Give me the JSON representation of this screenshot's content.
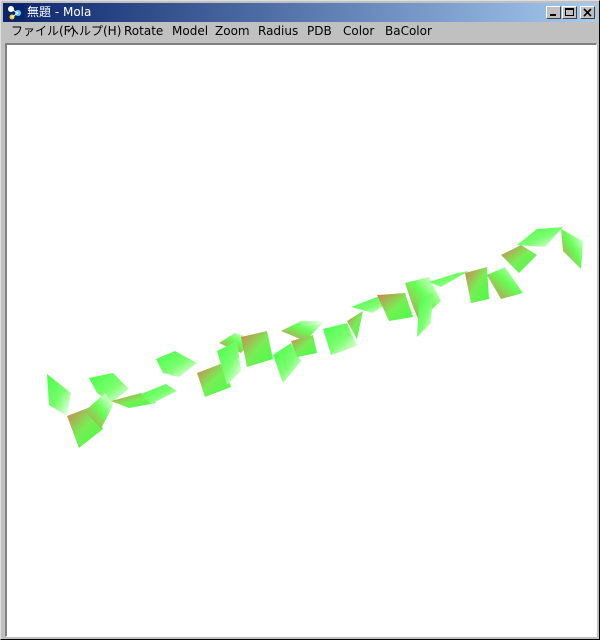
{
  "window": {
    "title": "無題 - Mola",
    "controls": [
      "minimize-button",
      "maximize-button",
      "close-button"
    ]
  },
  "menu": {
    "items": [
      {
        "name": "file",
        "label": "ファイル(F)"
      },
      {
        "name": "help",
        "label": "ヘルプ(H)"
      },
      {
        "name": "rotate",
        "label": "Rotate"
      },
      {
        "name": "model",
        "label": "Model"
      },
      {
        "name": "zoom",
        "label": "Zoom"
      },
      {
        "name": "radius",
        "label": "Radius"
      },
      {
        "name": "pdb",
        "label": "PDB"
      },
      {
        "name": "color",
        "label": "Color"
      },
      {
        "name": "bacolor",
        "label": "BaColor"
      }
    ]
  },
  "viewport": {
    "background": "#ffffff",
    "ribbon_colors": [
      "#44ff44",
      "#ffffff",
      "#d87a54"
    ]
  }
}
